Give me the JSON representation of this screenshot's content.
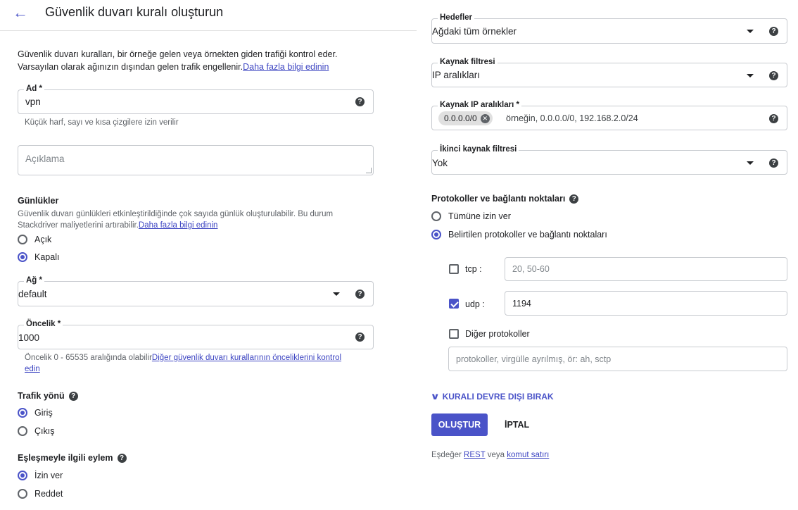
{
  "header": {
    "back_icon": "arrow-left-icon",
    "title": "Güvenlik duvarı kuralı oluşturun"
  },
  "intro": {
    "line1": "Güvenlik duvarı kuralları, bir örneğe gelen veya örnekten giden trafiği kontrol eder.",
    "line2": "Varsayılan olarak ağınızın dışından gelen trafik engellenir.",
    "link": "Daha fazla bilgi edinin"
  },
  "name": {
    "label": "Ad *",
    "value": "vpn",
    "hint": "Küçük harf, sayı ve kısa çizgilere izin verilir"
  },
  "description": {
    "placeholder": "Açıklama"
  },
  "logs": {
    "title": "Günlükler",
    "desc1": "Güvenlik duvarı günlükleri etkinleştirildiğinde çok sayıda günlük oluşturulabilir. Bu durum",
    "desc2": "Stackdriver maliyetlerini artırabilir.",
    "link": "Daha fazla bilgi edinin",
    "options": [
      "Açık",
      "Kapalı"
    ],
    "selected": "Kapalı"
  },
  "network": {
    "label": "Ağ *",
    "value": "default"
  },
  "priority": {
    "label": "Öncelik *",
    "value": "1000",
    "hint": "Öncelik 0 - 65535 aralığında olabilir",
    "link1": "Diğer güvenlik duvarı kurallarının önceliklerini kontrol",
    "link2": "edin"
  },
  "direction": {
    "title": "Trafik yönü",
    "options": [
      "Giriş",
      "Çıkış"
    ],
    "selected": "Giriş"
  },
  "action": {
    "title": "Eşleşmeyle ilgili eylem",
    "options": [
      "İzin ver",
      "Reddet"
    ],
    "selected": "İzin ver"
  },
  "targets": {
    "label": "Hedefler",
    "value": "Ağdaki tüm örnekler"
  },
  "source_filter": {
    "label": "Kaynak filtresi",
    "value": "IP aralıkları"
  },
  "source_ranges": {
    "label": "Kaynak IP aralıkları *",
    "chip": "0.0.0.0/0",
    "placeholder": "örneğin, 0.0.0.0/0, 192.168.2.0/24"
  },
  "second_filter": {
    "label": "İkinci kaynak filtresi",
    "value": "Yok"
  },
  "protocols": {
    "title": "Protokoller ve bağlantı noktaları",
    "options": [
      "Tümüne izin ver",
      "Belirtilen protokoller ve bağlantı noktaları"
    ],
    "selected": "Belirtilen protokoller ve bağlantı noktaları",
    "tcp": {
      "label": "tcp :",
      "checked": false,
      "placeholder": "20, 50-60"
    },
    "udp": {
      "label": "udp :",
      "checked": true,
      "value": "1194"
    },
    "other": {
      "label": "Diğer protokoller",
      "checked": false,
      "placeholder": "protokoller, virgülle ayrılmış, ör: ah, sctp"
    }
  },
  "disable_rule": "KURALI DEVRE DIŞI BIRAK",
  "buttons": {
    "create": "OLUŞTUR",
    "cancel": "İPTAL"
  },
  "footer": {
    "prefix": "Eşdeğer",
    "rest": "REST",
    "middle": "veya",
    "cli": "komut satırı"
  }
}
